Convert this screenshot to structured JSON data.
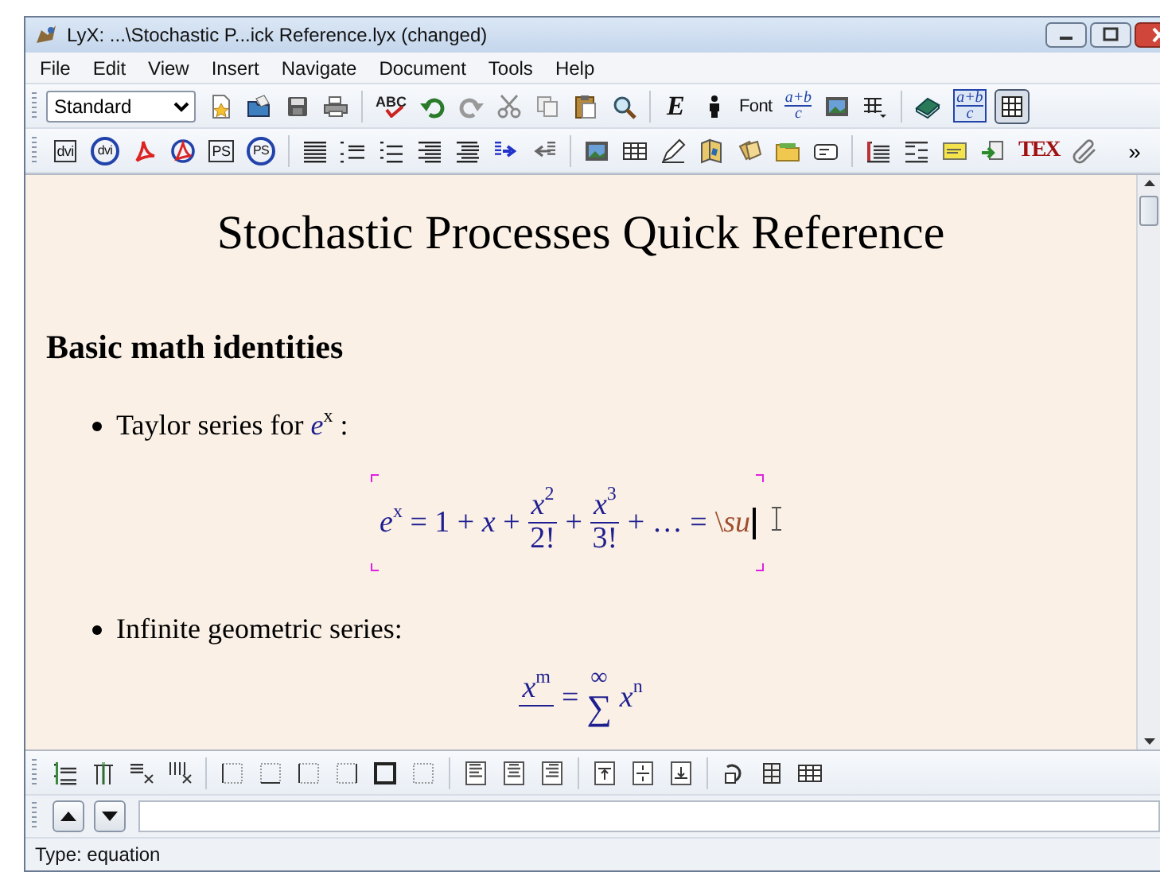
{
  "window": {
    "title": "LyX: ...\\Stochastic P...ick Reference.lyx (changed)"
  },
  "menu": [
    "File",
    "Edit",
    "View",
    "Insert",
    "Navigate",
    "Document",
    "Tools",
    "Help"
  ],
  "toolbar_main": {
    "style_select": {
      "value": "Standard"
    },
    "items": [
      {
        "kind": "icon",
        "on": false
      },
      {
        "kind": "icon",
        "on": false
      },
      {
        "kind": "icon",
        "on": false
      },
      {
        "kind": "icon",
        "on": false
      },
      {
        "kind": "sep"
      },
      {
        "kind": "check",
        "label": "ABC"
      },
      {
        "kind": "icon",
        "on": false
      },
      {
        "kind": "icon",
        "on": false
      },
      {
        "kind": "icon",
        "on": false
      },
      {
        "kind": "icon",
        "on": false
      },
      {
        "kind": "icon",
        "on": false
      },
      {
        "kind": "icon",
        "on": false
      },
      {
        "kind": "sep"
      },
      {
        "kind": "label",
        "label": "E",
        "on": false
      },
      {
        "kind": "icon",
        "on": false
      },
      {
        "kind": "label",
        "label": "Font",
        "on": false
      },
      {
        "kind": "frac",
        "num": "a+b",
        "den": "c",
        "on": false
      },
      {
        "kind": "icon",
        "on": false
      },
      {
        "kind": "icon",
        "on": false
      },
      {
        "kind": "sep"
      },
      {
        "kind": "icon",
        "on": false
      },
      {
        "kind": "frac",
        "num": "a+b",
        "den": "c",
        "on": false
      },
      {
        "kind": "icon",
        "on": true
      }
    ]
  },
  "toolbar_view": {
    "items": [
      {
        "kind": "label",
        "label": "dvi"
      },
      {
        "kind": "refresh",
        "label": "dvi"
      },
      {
        "kind": "icon"
      },
      {
        "kind": "icon"
      },
      {
        "kind": "label",
        "label": "PS"
      },
      {
        "kind": "refresh",
        "label": "PS"
      },
      {
        "kind": "sep"
      },
      {
        "kind": "icon"
      },
      {
        "kind": "icon"
      },
      {
        "kind": "icon"
      },
      {
        "kind": "icon"
      },
      {
        "kind": "icon"
      },
      {
        "kind": "icon"
      },
      {
        "kind": "icon"
      },
      {
        "kind": "sep"
      },
      {
        "kind": "icon"
      },
      {
        "kind": "icon"
      },
      {
        "kind": "icon"
      },
      {
        "kind": "icon"
      },
      {
        "kind": "icon"
      },
      {
        "kind": "icon"
      },
      {
        "kind": "icon"
      },
      {
        "kind": "sep"
      },
      {
        "kind": "icon"
      },
      {
        "kind": "icon"
      },
      {
        "kind": "icon"
      },
      {
        "kind": "icon"
      },
      {
        "kind": "tex",
        "label": "TEX"
      },
      {
        "kind": "icon"
      },
      {
        "kind": "more",
        "label": "»"
      }
    ]
  },
  "document": {
    "title": "Stochastic Processes Quick Reference",
    "section": "Basic math identities",
    "blocks": [
      {
        "kind": "bullet",
        "text": "Taylor series for *e*$^{x}$ :"
      },
      {
        "kind": "equation",
        "editing": true,
        "tokens": [
          {
            "kind": "text",
            "text": "*e*$^{x}$ = 1 + *x* +"
          },
          {
            "kind": "frac",
            "num": "*x*$^{2}$",
            "den": "2!"
          },
          {
            "kind": "text",
            "text": "+"
          },
          {
            "kind": "frac",
            "num": "*x*$^{3}$",
            "den": "3!"
          },
          {
            "kind": "text",
            "text": "+ … ="
          },
          {
            "kind": "macro",
            "text": "\\*su*"
          }
        ]
      },
      {
        "kind": "bullet",
        "text": "Infinite geometric series:"
      },
      {
        "kind": "equation",
        "editing": false,
        "tokens": [
          {
            "kind": "frac",
            "num": "*x*$^{m}$"
          },
          {
            "kind": "text",
            "text": "="
          },
          {
            "kind": "sum",
            "top": "∞",
            "symbol": "∑"
          },
          {
            "kind": "text",
            "text": "*x*$^{n}$"
          }
        ]
      }
    ]
  },
  "toolbar_math": {
    "items": [
      {
        "kind": "icon"
      },
      {
        "kind": "icon"
      },
      {
        "kind": "icon"
      },
      {
        "kind": "icon"
      },
      {
        "kind": "sep"
      },
      {
        "kind": "icon"
      },
      {
        "kind": "icon"
      },
      {
        "kind": "icon"
      },
      {
        "kind": "icon"
      },
      {
        "kind": "icon"
      },
      {
        "kind": "icon"
      },
      {
        "kind": "sep"
      },
      {
        "kind": "icon"
      },
      {
        "kind": "icon"
      },
      {
        "kind": "icon"
      },
      {
        "kind": "sep"
      },
      {
        "kind": "icon"
      },
      {
        "kind": "icon"
      },
      {
        "kind": "icon"
      },
      {
        "kind": "sep"
      },
      {
        "kind": "icon"
      },
      {
        "kind": "icon"
      },
      {
        "kind": "icon"
      }
    ]
  },
  "status_bar": {
    "text": "Type: equation"
  }
}
